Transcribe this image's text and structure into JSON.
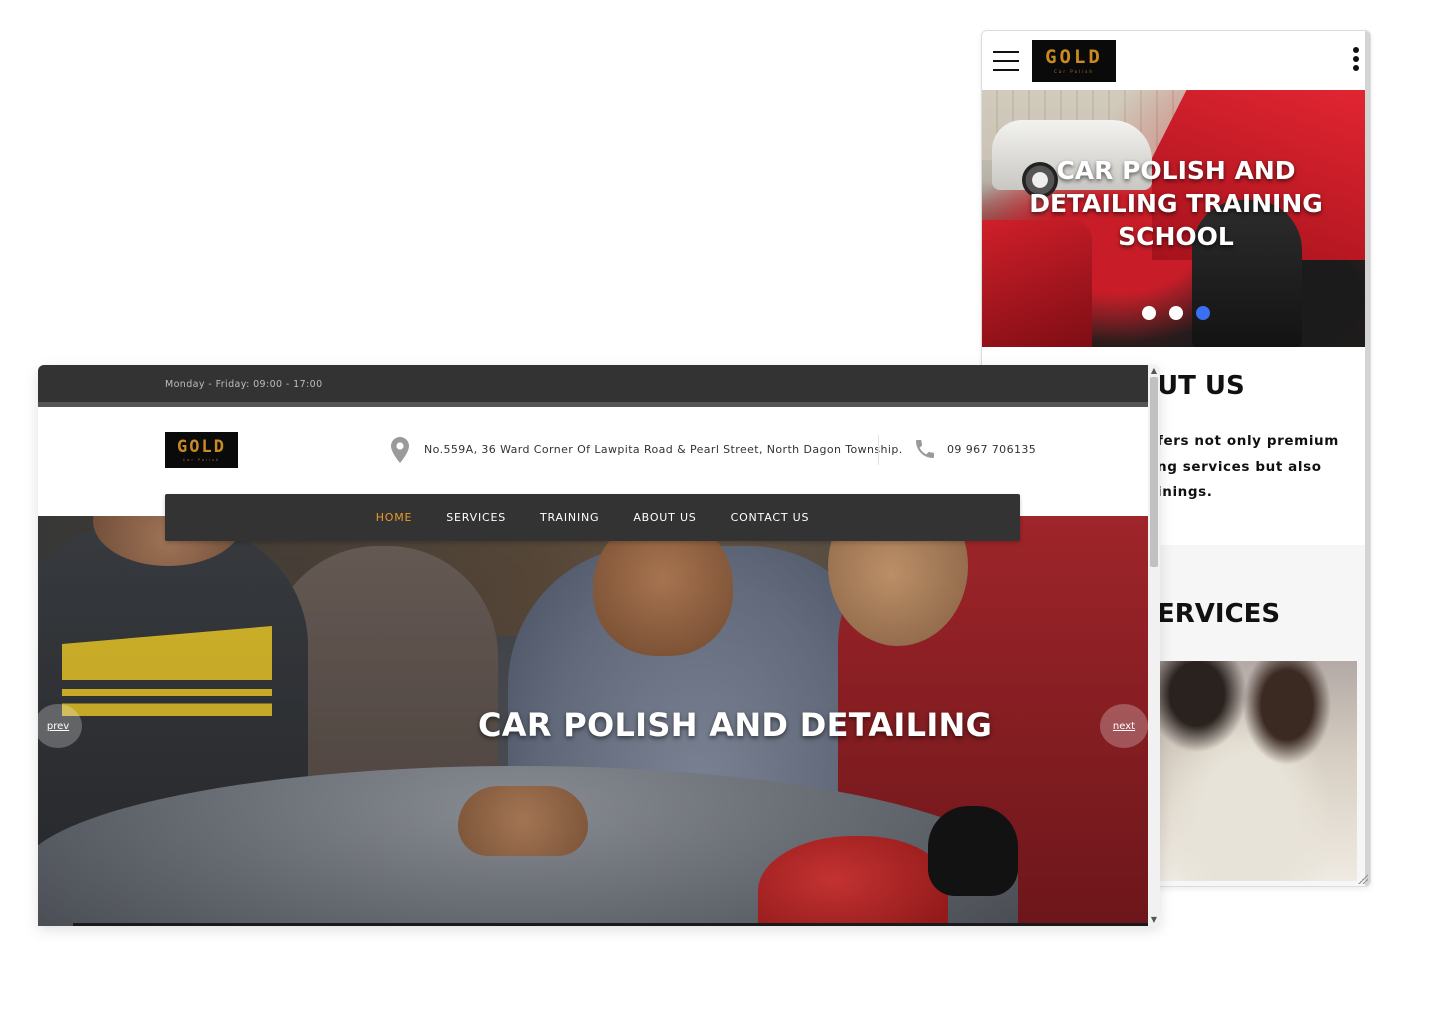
{
  "brand": {
    "name": "GOLD",
    "tagline": "Car Polish"
  },
  "colors": {
    "accent": "#e99a2a",
    "dark_bar": "#333333",
    "dot_active": "#3b6ff2",
    "logo_gold": "#c98a22"
  },
  "mobile": {
    "icons": {
      "menu": "hamburger-icon",
      "more": "kebab-menu-icon"
    },
    "hero": {
      "title_lines": [
        "CAR POLISH AND",
        "DETAILING TRAINING",
        "SCHOOL"
      ],
      "slide_dots": 3,
      "active_dot": 3
    },
    "about": {
      "title": "UT US",
      "text_lines": [
        "fers not only premium",
        "ng services but also",
        "inings."
      ]
    },
    "services": {
      "title": "ERVICES"
    }
  },
  "desktop": {
    "topbar": {
      "hours": "Monday - Friday: 09:00 - 17:00"
    },
    "header": {
      "address_icon": "map-pin-icon",
      "address": "No.559A, 36 Ward Corner Of Lawpita Road & Pearl Street, North Dagon Township.",
      "phone_icon": "phone-icon",
      "phone": "09 967 706135"
    },
    "nav": {
      "items": [
        {
          "label": "HOME",
          "active": true
        },
        {
          "label": "SERVICES",
          "active": false
        },
        {
          "label": "TRAINING",
          "active": false
        },
        {
          "label": "ABOUT US",
          "active": false
        },
        {
          "label": "CONTACT US",
          "active": false
        }
      ]
    },
    "hero": {
      "title": "CAR POLISH AND DETAILING",
      "prev_label": "prev",
      "next_label": "next"
    }
  }
}
